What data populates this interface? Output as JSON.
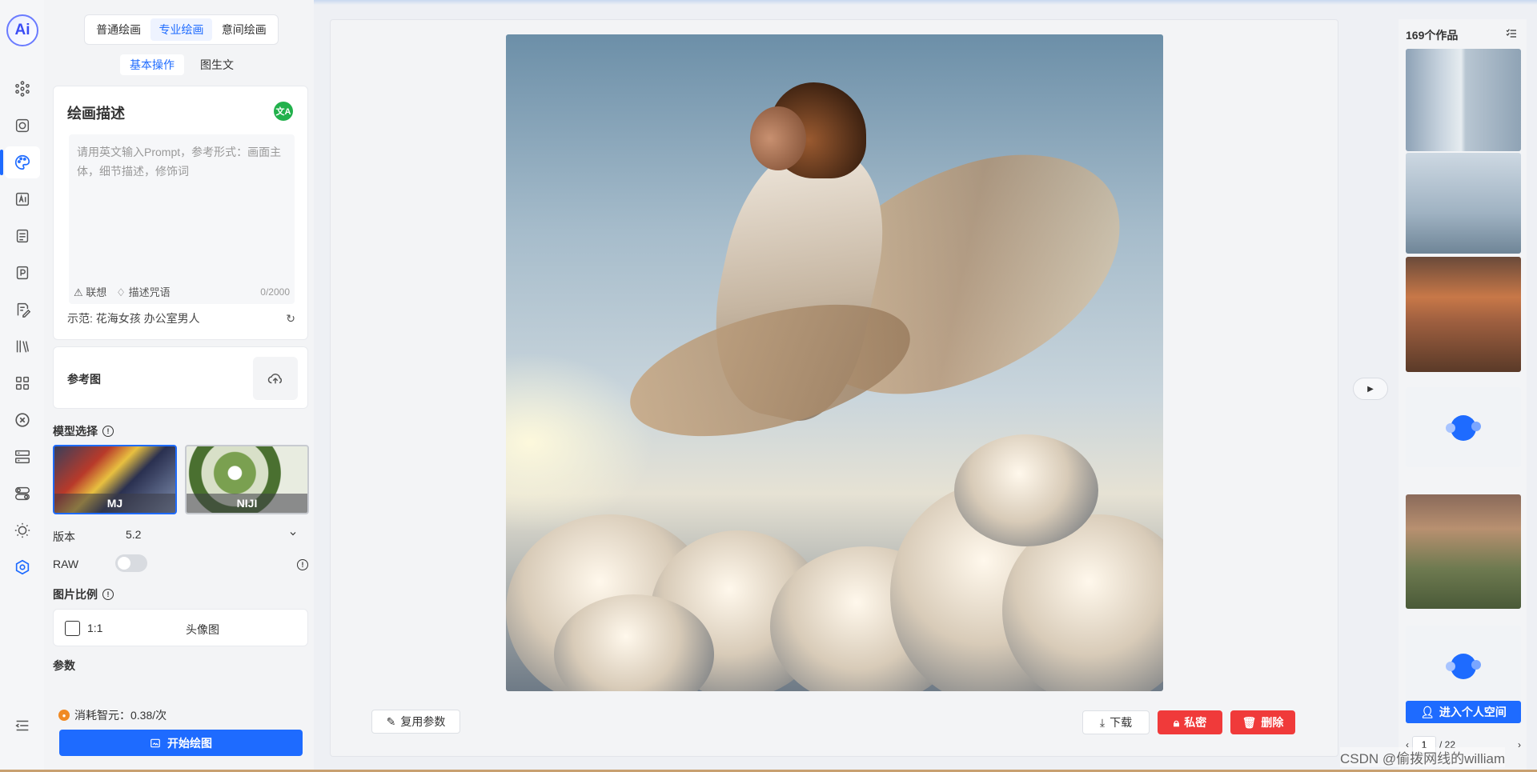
{
  "app": {
    "logo_text": "Ai"
  },
  "rail": {
    "items": [
      {
        "name": "rail-item-model",
        "icon": "nodes-icon"
      },
      {
        "name": "rail-item-chat",
        "icon": "chat-icon"
      },
      {
        "name": "rail-item-paint",
        "icon": "palette-icon",
        "active": true
      },
      {
        "name": "rail-item-ai",
        "icon": "ai-icon"
      },
      {
        "name": "rail-item-doc",
        "icon": "document-icon"
      },
      {
        "name": "rail-item-ppt",
        "icon": "ppt-icon"
      },
      {
        "name": "rail-item-write",
        "icon": "edit-icon"
      },
      {
        "name": "rail-item-library",
        "icon": "library-icon"
      },
      {
        "name": "rail-item-apps",
        "icon": "grid-icon"
      },
      {
        "name": "rail-item-open",
        "icon": "openai-icon"
      },
      {
        "name": "rail-item-server",
        "icon": "server-icon"
      },
      {
        "name": "rail-item-toggle",
        "icon": "toggles-icon"
      },
      {
        "name": "rail-item-theme",
        "icon": "sun-icon"
      },
      {
        "name": "rail-item-hex",
        "icon": "hexagon-icon"
      },
      {
        "name": "rail-item-collapse",
        "icon": "collapse-icon"
      }
    ]
  },
  "panel": {
    "mode_tabs": [
      "普通绘画",
      "专业绘画",
      "意间绘画"
    ],
    "sub_tabs": [
      "基本操作",
      "图生文"
    ],
    "desc": {
      "title": "绘画描述",
      "translate_label": "文A",
      "placeholder": "请用英文输入Prompt，参考形式：画面主体，细节描述，修饰词",
      "associate": "联想",
      "spell": "描述咒语",
      "count": "0/2000",
      "example": "示范: 花海女孩 办公室男人"
    },
    "reference": {
      "title": "参考图"
    },
    "model": {
      "label": "模型选择",
      "options": [
        "MJ",
        "NIJI"
      ]
    },
    "version": {
      "label": "版本",
      "value": "5.2"
    },
    "raw": {
      "label": "RAW",
      "enabled": false
    },
    "ratio": {
      "label": "图片比例",
      "value": "1:1",
      "name": "头像图"
    },
    "params_label": "参数",
    "cost": "消耗智元：0.38/次",
    "start_button": "开始绘图"
  },
  "main": {
    "reuse_button": "复用参数",
    "download_button": "下载",
    "private_button": "私密",
    "delete_button": "删除"
  },
  "gallery": {
    "title": "169个作品",
    "enter_button": "进入个人空间",
    "page": "1",
    "page_total": "/ 22"
  },
  "watermark": "CSDN @偷拨网线的william",
  "colors": {
    "accent": "#1e6bff",
    "danger": "#f03a3a",
    "translate": "#22b14c"
  }
}
